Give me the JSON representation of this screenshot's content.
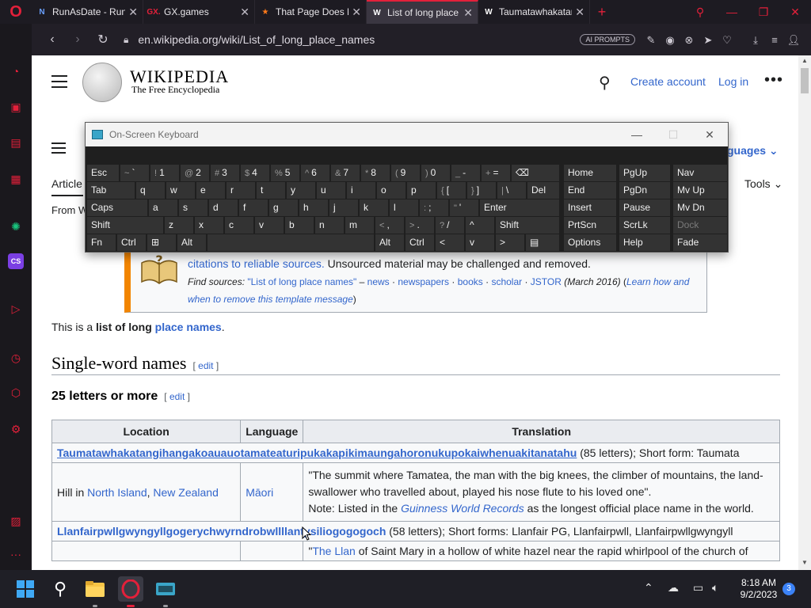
{
  "browser": {
    "tabs": [
      {
        "title": "RunAsDate - Run",
        "favicon": "N",
        "favcolor": "#6aa0ff",
        "active": false
      },
      {
        "title": "GX.games",
        "favicon": "GX.",
        "favcolor": "#e3203a",
        "active": false
      },
      {
        "title": "That Page Does N",
        "favicon": "★",
        "favcolor": "#ff7a1a",
        "active": false
      },
      {
        "title": "List of long place",
        "favicon": "W",
        "favcolor": "#ffffff",
        "active": true
      },
      {
        "title": "Taumatawhakatan",
        "favicon": "W",
        "favcolor": "#ffffff",
        "active": false
      }
    ],
    "url": "en.wikipedia.org/wiki/List_of_long_place_names",
    "ai_badge": "AI PROMPTS",
    "accent": "#e3203a"
  },
  "wiki": {
    "wordmark": "WIKIPEDIA",
    "tagline": "The Free Encyclopedia",
    "create_account": "Create account",
    "log_in": "Log in",
    "languages": "guages",
    "article_tab": "Article",
    "tools": "Tools",
    "from_w": "From W",
    "notice": {
      "line1_link": "citations to reliable sources.",
      "line1_rest": " Unsourced material may be challenged and removed.",
      "find_sources": "Find sources:",
      "q": "\"List of long place names\"",
      "dash": " – ",
      "news": "news",
      "newspapers": "newspapers",
      "books": "books",
      "scholar": "scholar",
      "jstor": "JSTOR",
      "date": "(March 2016)",
      "learn": "Learn how and",
      "when": "when to remove this template message",
      "dot": " · ",
      "open_paren": " (",
      "close_paren": ")"
    },
    "intro_pre": "This is a ",
    "intro_bold": "list of long",
    "intro_link": "place names",
    "intro_end": ".",
    "h2": "Single-word names",
    "h3": "25 letters or more",
    "edit": "edit",
    "bracket_open": "[ ",
    "bracket_close": " ]",
    "table": {
      "headers": [
        "Location",
        "Language",
        "Translation"
      ],
      "row1_name": "Taumatawhakatangihangakoauauotamateaturipukakapikimaungahoronukupokaiwhenuakitanatahu",
      "row1_rest": " (85 letters); Short form: Taumata",
      "row2_loc_pre": "Hill in ",
      "row2_loc_link1": "North Island",
      "row2_loc_sep": ", ",
      "row2_loc_link2": "New Zealand",
      "row2_lang": "Māori",
      "row2_trans": "\"The summit where Tamatea, the man with the big knees, the climber of mountains, the land-swallower who travelled about, played his nose flute to his loved one\".",
      "row2_note_pre": "Note: Listed in the ",
      "row2_note_link": "Guinness World Records",
      "row2_note_rest": " as the longest official place name in the world.",
      "row3_name": "Llanfairpwllgwyngyllgogerychwyrndrobwllllantysiliogogogoch",
      "row3_rest": " (58 letters); Short forms: Llanfair PG, Llanfairpwll, Llanfairpwllgwyngyll",
      "row4_pre": "\"",
      "row4_link": "The Llan",
      "row4_rest": " of Saint Mary in a hollow of white hazel near the rapid whirlpool of the church of"
    }
  },
  "osk": {
    "title": "On-Screen Keyboard",
    "rows": [
      [
        [
          "Esc",
          ""
        ],
        [
          "`",
          "~"
        ],
        [
          "1",
          "!"
        ],
        [
          "2",
          "@"
        ],
        [
          "3",
          "#"
        ],
        [
          "4",
          "$"
        ],
        [
          "5",
          "%"
        ],
        [
          "6",
          "^"
        ],
        [
          "7",
          "&"
        ],
        [
          "8",
          "*"
        ],
        [
          "9",
          "("
        ],
        [
          "0",
          ")"
        ],
        [
          "-",
          "_"
        ],
        [
          "=",
          "+"
        ],
        [
          "⌫",
          ""
        ]
      ],
      [
        [
          "Tab",
          ""
        ],
        [
          "q",
          ""
        ],
        [
          "w",
          ""
        ],
        [
          "e",
          ""
        ],
        [
          "r",
          ""
        ],
        [
          "t",
          ""
        ],
        [
          "y",
          ""
        ],
        [
          "u",
          ""
        ],
        [
          "i",
          ""
        ],
        [
          "o",
          ""
        ],
        [
          "p",
          ""
        ],
        [
          "[",
          "{"
        ],
        [
          "]",
          "}"
        ],
        [
          "\\",
          "|"
        ],
        [
          "Del",
          ""
        ]
      ],
      [
        [
          "Caps",
          ""
        ],
        [
          "a",
          ""
        ],
        [
          "s",
          ""
        ],
        [
          "d",
          ""
        ],
        [
          "f",
          ""
        ],
        [
          "g",
          ""
        ],
        [
          "h",
          ""
        ],
        [
          "j",
          ""
        ],
        [
          "k",
          ""
        ],
        [
          "l",
          ""
        ],
        [
          ";",
          ":"
        ],
        [
          "'",
          "\""
        ],
        [
          "Enter",
          ""
        ]
      ],
      [
        [
          "Shift",
          ""
        ],
        [
          "z",
          ""
        ],
        [
          "x",
          ""
        ],
        [
          "c",
          ""
        ],
        [
          "v",
          ""
        ],
        [
          "b",
          ""
        ],
        [
          "n",
          ""
        ],
        [
          "m",
          ""
        ],
        [
          ",",
          "<"
        ],
        [
          ".",
          ">"
        ],
        [
          "/",
          "?"
        ],
        [
          "^",
          ""
        ],
        [
          "Shift",
          ""
        ]
      ],
      [
        [
          "Fn",
          ""
        ],
        [
          "Ctrl",
          ""
        ],
        [
          "⊞",
          ""
        ],
        [
          "Alt",
          ""
        ],
        [
          "",
          ""
        ],
        [
          "Alt",
          ""
        ],
        [
          "Ctrl",
          ""
        ],
        [
          "<",
          ""
        ],
        [
          "v",
          ""
        ],
        [
          ">",
          ""
        ],
        [
          "▤",
          ""
        ]
      ]
    ],
    "nav": [
      [
        "Home",
        "PgUp",
        "Nav"
      ],
      [
        "End",
        "PgDn",
        "Mv Up"
      ],
      [
        "Insert",
        "Pause",
        "Mv Dn"
      ],
      [
        "PrtScn",
        "ScrLk",
        "Dock"
      ],
      [
        "Options",
        "Help",
        "Fade"
      ]
    ]
  },
  "taskbar": {
    "time": "8:18 AM",
    "date": "9/2/2023",
    "notifications": "3"
  }
}
